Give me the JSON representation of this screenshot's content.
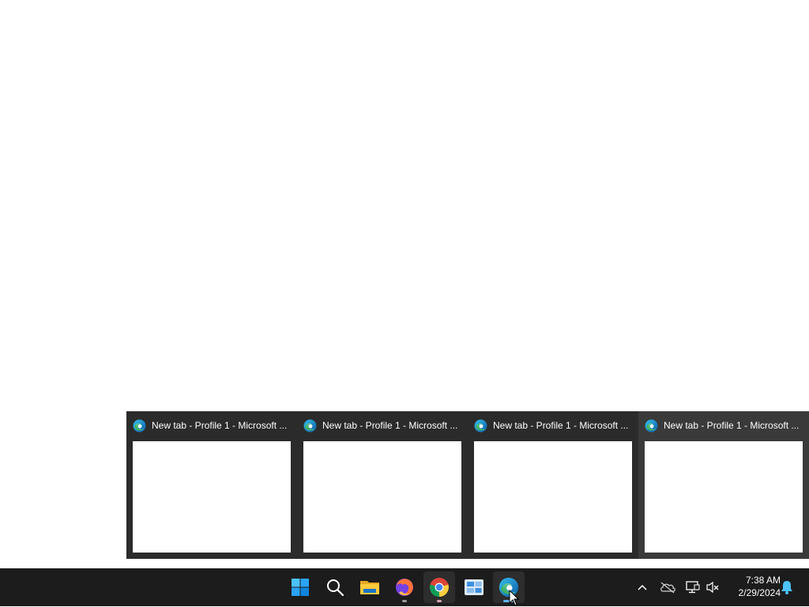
{
  "previews": [
    {
      "title": "New tab - Profile 1 - Microsoft ...",
      "icon": "edge-icon"
    },
    {
      "title": "New tab - Profile 1 - Microsoft ...",
      "icon": "edge-icon"
    },
    {
      "title": "New tab - Profile 1 - Microsoft ...",
      "icon": "edge-icon"
    },
    {
      "title": "New tab - Profile 1 - Microsoft ...",
      "icon": "edge-icon"
    }
  ],
  "taskbar": {
    "apps": [
      "start-icon",
      "search-icon",
      "file-explorer-icon",
      "firefox-icon",
      "chrome-icon",
      "widgets-icon",
      "edge-icon"
    ]
  },
  "tray": {
    "icons": [
      "chevron-up-icon",
      "onedrive-offline-icon",
      "network-icon",
      "speaker-muted-icon",
      "notification-bell-icon"
    ]
  },
  "clock": {
    "time": "7:38 AM",
    "date": "2/29/2024"
  },
  "colors": {
    "taskbar_bg": "#1c1c1c",
    "preview_bg": "#2b2b2b",
    "accent": "#0078d4"
  }
}
